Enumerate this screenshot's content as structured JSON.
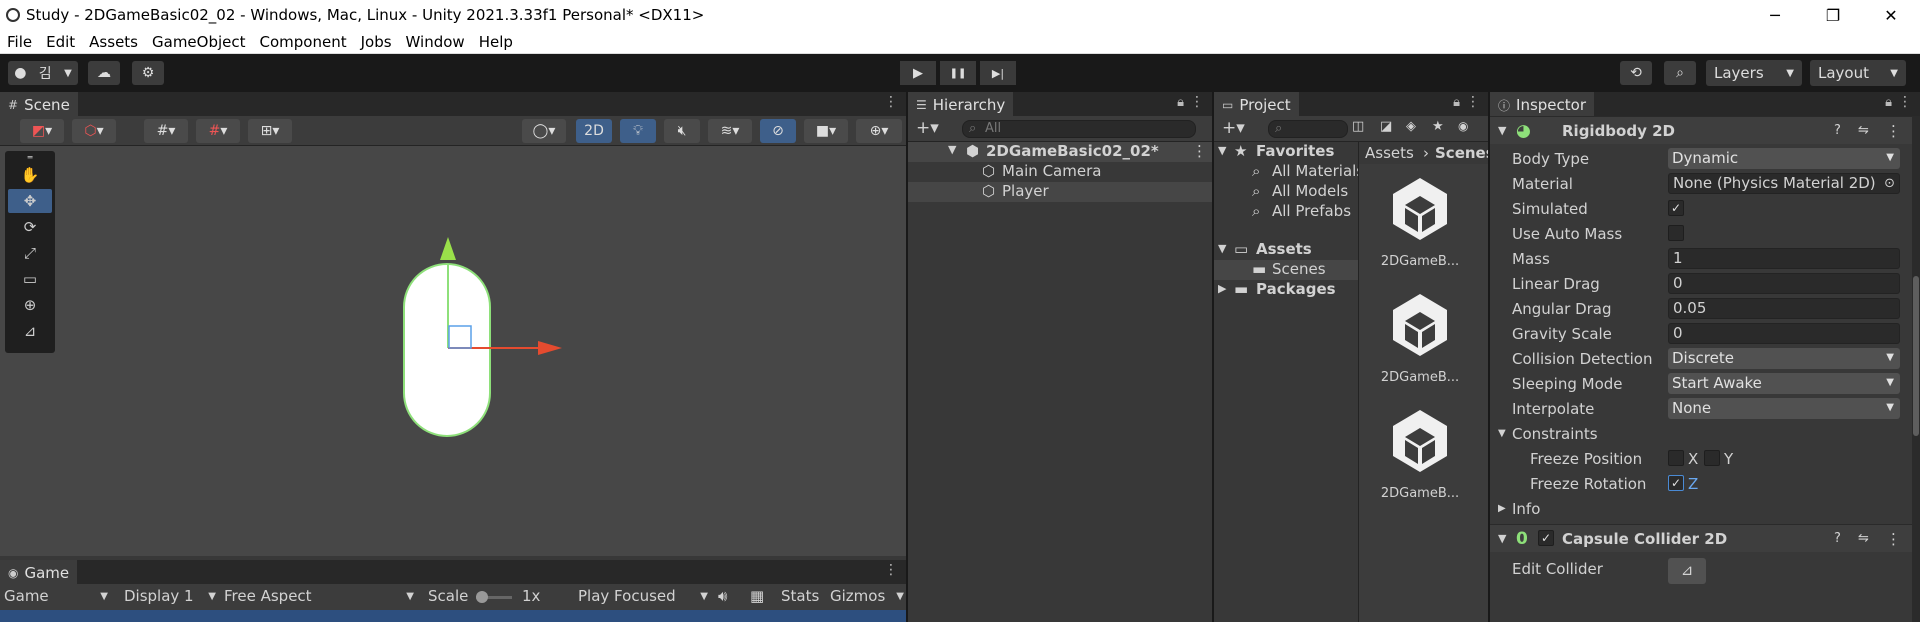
{
  "window": {
    "title": "Study - 2DGameBasic02_02 - Windows, Mac, Linux - Unity 2021.3.33f1 Personal* <DX11>",
    "minimize": "─",
    "restore": "❐",
    "close": "✕"
  },
  "menu": [
    "File",
    "Edit",
    "Assets",
    "GameObject",
    "Component",
    "Jobs",
    "Window",
    "Help"
  ],
  "toolbar": {
    "account": "김",
    "layers": "Layers",
    "layout": "Layout",
    "play": "▶",
    "pause": "❚❚",
    "step": "▶|"
  },
  "scene": {
    "tab": "Scene",
    "mode_2d": "2D",
    "tools": [
      "✋",
      "✥",
      "⟳",
      "⤢",
      "▭",
      "⊕",
      "⊿"
    ]
  },
  "game": {
    "tab": "Game",
    "view": "Game",
    "display": "Display 1",
    "aspect": "Free Aspect",
    "scale_label": "Scale",
    "scale_value": "1x",
    "play_mode": "Play Focused",
    "stats": "Stats",
    "gizmos": "Gizmos"
  },
  "hierarchy": {
    "tab": "Hierarchy",
    "search_placeholder": "All",
    "scene_name": "2DGameBasic02_02*",
    "items": [
      "Main Camera",
      "Player"
    ]
  },
  "project": {
    "tab": "Project",
    "favorites_label": "Favorites",
    "favorites": [
      "All Materials",
      "All Models",
      "All Prefabs"
    ],
    "assets_label": "Assets",
    "scenes_label": "Scenes",
    "packages_label": "Packages",
    "breadcrumb": [
      "Assets",
      "Scenes"
    ],
    "assets": [
      "2DGameB...",
      "2DGameB...",
      "2DGameB..."
    ]
  },
  "inspector": {
    "tab": "Inspector",
    "rigidbody": {
      "title": "Rigidbody 2D",
      "body_type": {
        "label": "Body Type",
        "value": "Dynamic"
      },
      "material": {
        "label": "Material",
        "value": "None (Physics Material 2D)"
      },
      "simulated": {
        "label": "Simulated",
        "checked": true
      },
      "auto_mass": {
        "label": "Use Auto Mass",
        "checked": false
      },
      "mass": {
        "label": "Mass",
        "value": "1"
      },
      "linear_drag": {
        "label": "Linear Drag",
        "value": "0"
      },
      "angular_drag": {
        "label": "Angular Drag",
        "value": "0.05"
      },
      "gravity_scale": {
        "label": "Gravity Scale",
        "value": "0"
      },
      "collision_detection": {
        "label": "Collision Detection",
        "value": "Discrete"
      },
      "sleeping_mode": {
        "label": "Sleeping Mode",
        "value": "Start Awake"
      },
      "interpolate": {
        "label": "Interpolate",
        "value": "None"
      },
      "constraints": {
        "label": "Constraints"
      },
      "freeze_position": {
        "label": "Freeze Position",
        "x": "X",
        "y": "Y"
      },
      "freeze_rotation": {
        "label": "Freeze Rotation",
        "z": "Z"
      },
      "info": {
        "label": "Info"
      }
    },
    "capsule": {
      "title": "Capsule Collider 2D",
      "edit_collider": "Edit Collider"
    }
  }
}
